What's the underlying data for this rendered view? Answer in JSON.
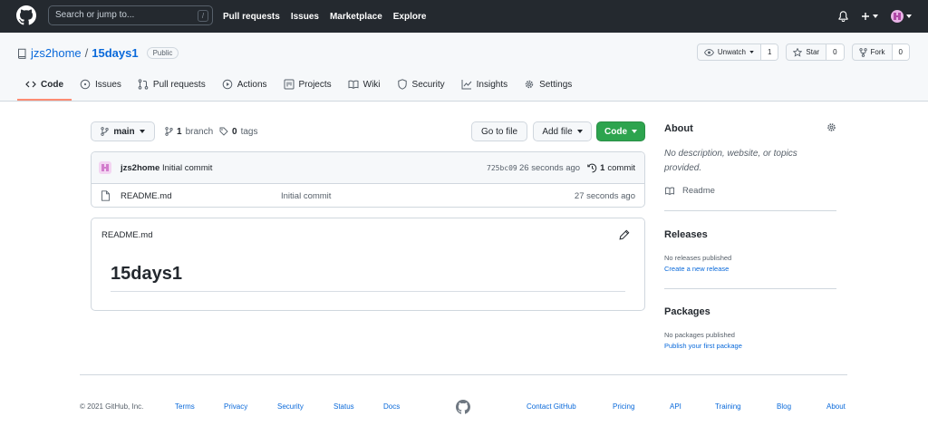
{
  "header": {
    "search_placeholder": "Search or jump to...",
    "search_shortcut": "/",
    "nav": [
      "Pull requests",
      "Issues",
      "Marketplace",
      "Explore"
    ]
  },
  "repo": {
    "owner": "jzs2home",
    "separator": "/",
    "name": "15days1",
    "visibility": "Public",
    "watch": {
      "label": "Unwatch",
      "count": "1"
    },
    "star": {
      "label": "Star",
      "count": "0"
    },
    "fork": {
      "label": "Fork",
      "count": "0"
    }
  },
  "tabs": [
    {
      "label": "Code",
      "icon": "code-icon",
      "active": true
    },
    {
      "label": "Issues",
      "icon": "issue-icon"
    },
    {
      "label": "Pull requests",
      "icon": "pull-request-icon"
    },
    {
      "label": "Actions",
      "icon": "play-icon"
    },
    {
      "label": "Projects",
      "icon": "project-icon"
    },
    {
      "label": "Wiki",
      "icon": "book-icon"
    },
    {
      "label": "Security",
      "icon": "shield-icon"
    },
    {
      "label": "Insights",
      "icon": "graph-icon"
    },
    {
      "label": "Settings",
      "icon": "gear-icon"
    }
  ],
  "toolbar": {
    "branch": "main",
    "branches_count": "1",
    "branches_label": "branch",
    "tags_count": "0",
    "tags_label": "tags",
    "goto_file": "Go to file",
    "add_file": "Add file",
    "code": "Code"
  },
  "latest_commit": {
    "author": "jzs2home",
    "message": "Initial commit",
    "sha": "725bc09",
    "time": "26 seconds ago",
    "commit_count": "1",
    "commit_label": "commit"
  },
  "files": [
    {
      "name": "README.md",
      "message": "Initial commit",
      "age": "27 seconds ago"
    }
  ],
  "readme": {
    "filename": "README.md",
    "heading": "15days1"
  },
  "sidebar": {
    "about_title": "About",
    "about_desc": "No description, website, or topics provided.",
    "readme_label": "Readme",
    "releases_title": "Releases",
    "releases_text": "No releases published",
    "releases_link": "Create a new release",
    "packages_title": "Packages",
    "packages_text": "No packages published",
    "packages_link": "Publish your first package"
  },
  "footer": {
    "copyright": "© 2021 GitHub, Inc.",
    "links_left": [
      "Terms",
      "Privacy",
      "Security",
      "Status",
      "Docs"
    ],
    "links_right": [
      "Contact GitHub",
      "Pricing",
      "API",
      "Training",
      "Blog",
      "About"
    ]
  },
  "colors": {
    "header_bg": "#24292f",
    "link": "#0969da",
    "code_button": "#2da44e",
    "active_tab_underline": "#fd8c73"
  }
}
